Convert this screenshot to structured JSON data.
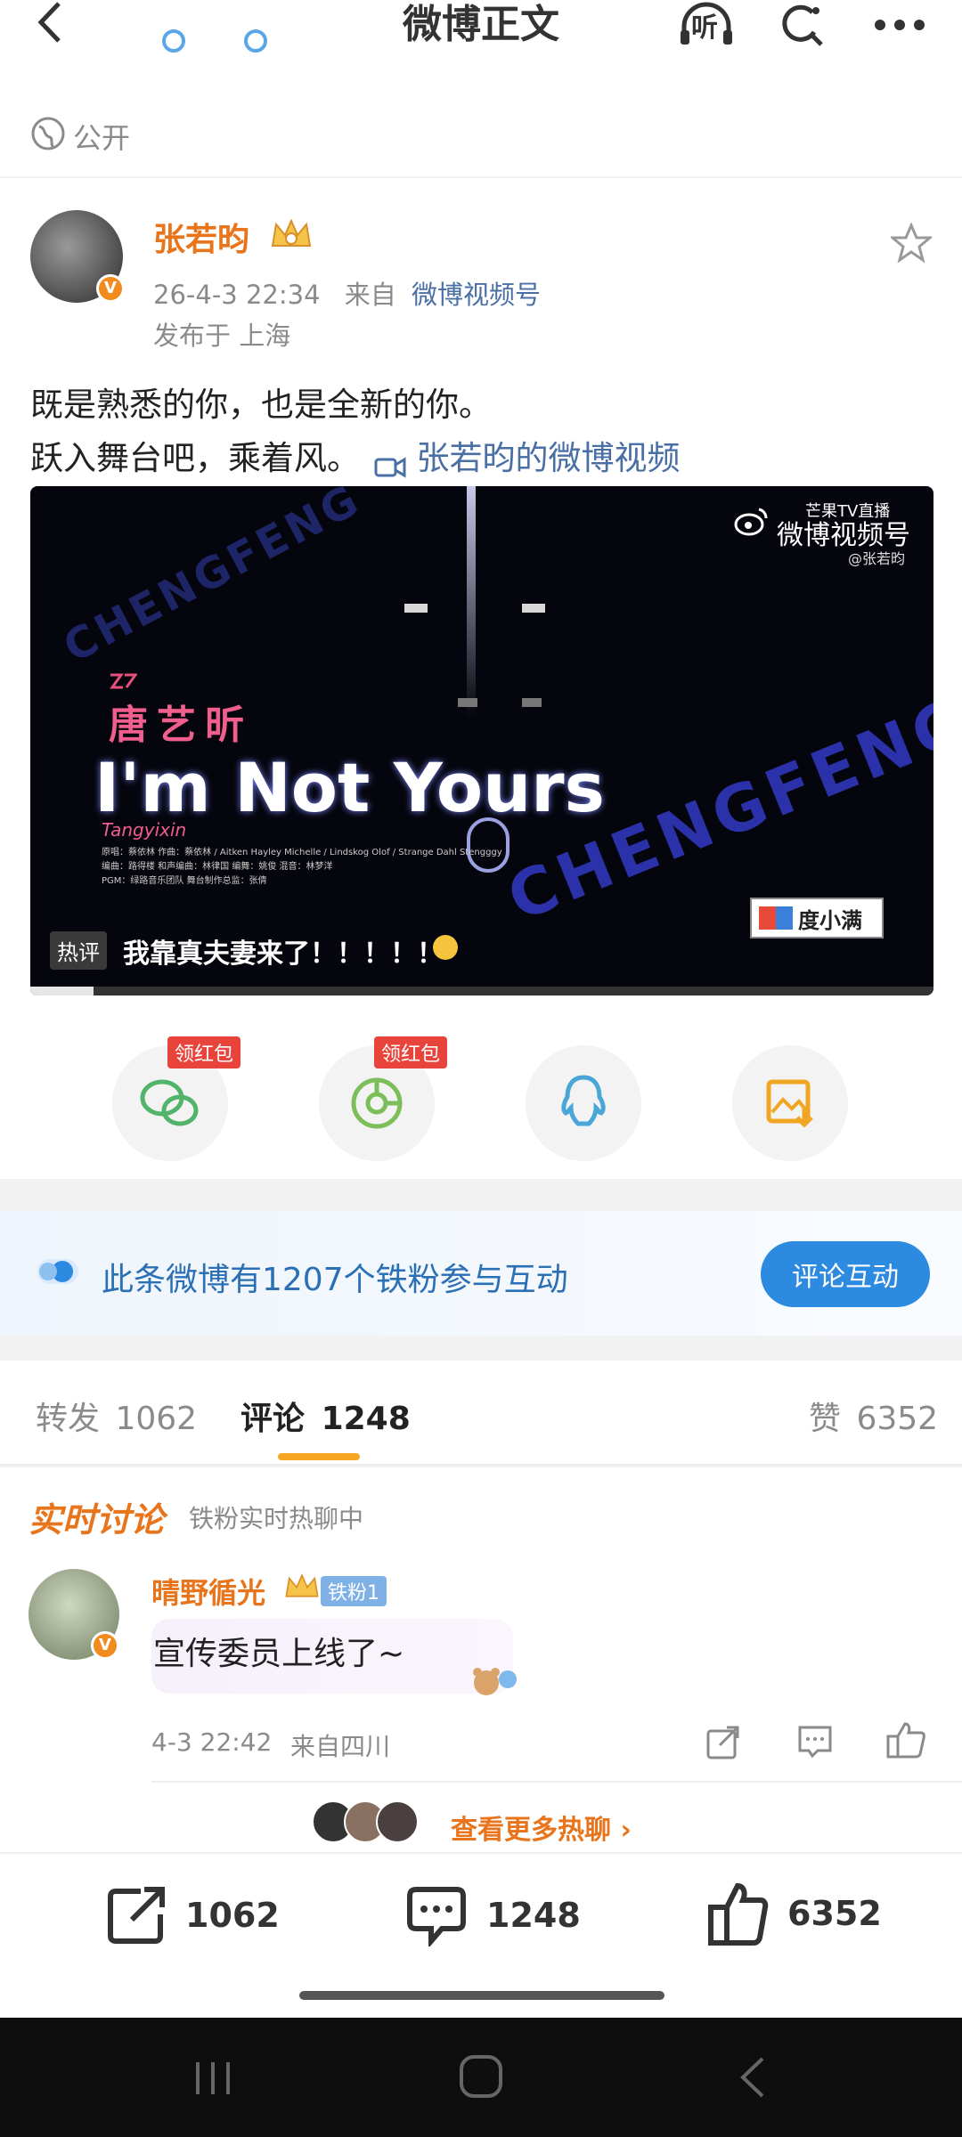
{
  "header": {
    "title": "微博正文",
    "listen_label": "听"
  },
  "visibility": {
    "label": "公开"
  },
  "post": {
    "author": "张若昀",
    "date": "26-4-3 22:34",
    "from_prefix": "来自",
    "source": "微博视频号",
    "location": "发布于 上海",
    "text_line1": "既是熟悉的你，也是全新的你。",
    "text_line2": "跃入舞台吧，乘着风。",
    "video_link": "张若昀的微博视频"
  },
  "video": {
    "watermark_top": "芒果TV直播",
    "watermark_main": "微博视频号",
    "watermark_handle": "@张若昀",
    "artist": "唐艺昕",
    "song_title": "I'm Not Yours",
    "signature": "Tangyixin",
    "credits_line1": "原唱：蔡依林   作曲：蔡依林 / Aitken Hayley Michelle / Lindskog Olof / Strange Dahl Stengggy",
    "credits_line2": "编曲：路得楼   和声编曲：林律国   编舞：姚俊   混音：林梦洋",
    "credits_line3": "PGM：绿路音乐团队   舞台制作总监：张倩",
    "stage_text": "CHENGFENG",
    "sponsor": "度小满",
    "hot_label": "热评",
    "hot_comment": "我靠真夫妻来了！！！！！",
    "progress": 0.07
  },
  "share": {
    "red_packet_label": "领红包",
    "items": [
      {
        "name": "wechat-icon",
        "color": "#52b46b"
      },
      {
        "name": "moments-icon",
        "color": "#7cbf5a"
      },
      {
        "name": "qq-icon",
        "color": "#4ba6d8"
      },
      {
        "name": "save-image-icon",
        "color": "#f0a623"
      }
    ]
  },
  "fans_banner": {
    "text": "此条微博有1207个铁粉参与互动",
    "button": "评论互动"
  },
  "tabs": {
    "repost_label": "转发",
    "repost_count": "1062",
    "comment_label": "评论",
    "comment_count": "1248",
    "like_label": "赞",
    "like_count": "6352"
  },
  "live_discussion": {
    "title": "实时讨论",
    "subtitle": "铁粉实时热聊中"
  },
  "comment": {
    "user": "晴野循光",
    "badge": "铁粉1",
    "text": "宣传委员上线了~",
    "date": "4-3 22:42",
    "location": "来自四川"
  },
  "more_hot": {
    "label": "查看更多热聊"
  },
  "bottom_bar": {
    "repost": "1062",
    "comment": "1248",
    "like": "6352"
  },
  "colors": {
    "accent_orange": "#e8741b",
    "link_blue": "#4a6fa5",
    "button_blue": "#2c8ae0"
  }
}
